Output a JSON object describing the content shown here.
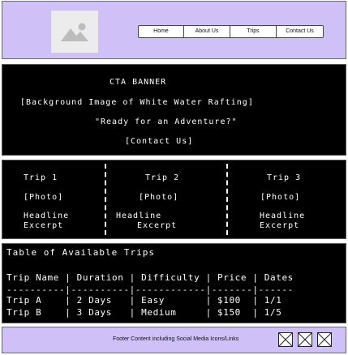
{
  "header": {
    "logo_icon": "image-placeholder-icon",
    "nav": [
      "Home",
      "About Us",
      "Trips",
      "Contact Us"
    ]
  },
  "cta": {
    "title": "CTA BANNER",
    "background_note": "[Background Image of White Water Rafting]",
    "tagline": "\"Ready for an Adventure?\"",
    "button": "[Contact Us]"
  },
  "trips": [
    {
      "title": "Trip 1",
      "photo": "[Photo]",
      "headline": "Headline",
      "excerpt": "Excerpt"
    },
    {
      "title": "Trip 2",
      "photo": "[Photo]",
      "headline": "Headline",
      "excerpt": "Excerpt"
    },
    {
      "title": "Trip 3",
      "photo": "[Photo]",
      "headline": "Headline",
      "excerpt": "Excerpt"
    }
  ],
  "table": {
    "title": "Table of Available Trips",
    "header_line": "Trip Name | Duration | Difficulty | Price | Dates",
    "separator_line": "----------|----------|------------|-------|------",
    "rows": [
      "Trip A    | 2 Days   | Easy       | $100  | 1/1",
      "Trip B    | 3 Days   | Medium     | $150  | 1/5"
    ]
  },
  "footer": {
    "text": "Footer Content including Social Media Icons/Links",
    "social_icons": [
      "social-placeholder-icon",
      "social-placeholder-icon",
      "social-placeholder-icon"
    ]
  },
  "colors": {
    "header_bg": "#cfc1f7",
    "footer_bg": "#cfc1f7",
    "panel_bg": "#000000",
    "panel_text": "#ffffff"
  }
}
